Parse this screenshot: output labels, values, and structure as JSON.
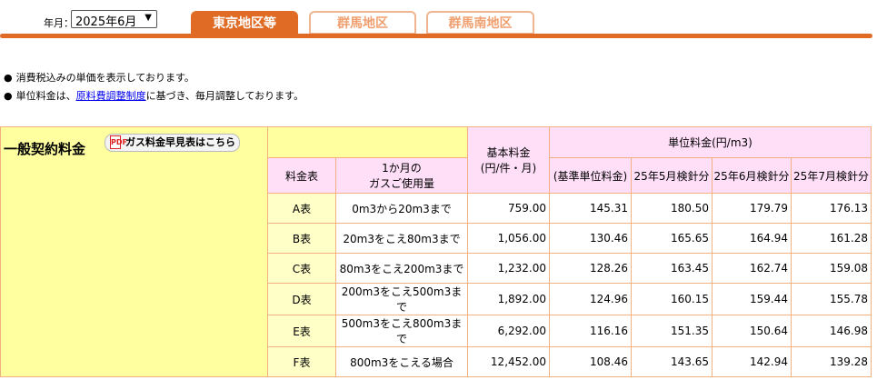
{
  "header": {
    "month_label": "年月：",
    "month_select_value": "2025年6月",
    "tabs": [
      {
        "label": "東京地区等",
        "active": true
      },
      {
        "label": "群馬地区",
        "active": false
      },
      {
        "label": "群馬南地区",
        "active": false
      }
    ]
  },
  "notes": {
    "line1": "消費税込みの単価を表示しております。",
    "line2_prefix": "単位料金は、",
    "line2_link": "原料費調整制度",
    "line2_suffix": "に基づき、毎月調整しております。",
    "bullet": "●"
  },
  "section": {
    "title": "一般契約料金",
    "pdf_button": "ガス料金早見表はこちら",
    "pdf_icon_text": "PDF"
  },
  "table": {
    "col_rate_table": "料金表",
    "col_usage_line1": "1か月の",
    "col_usage_line2": "ガスご使用量",
    "col_basic_line1": "基本料金",
    "col_basic_line2": "(円/件・月)",
    "col_unit_group": "単位料金(円/m3)",
    "col_unit_sub": [
      "(基準単位料金)",
      "25年5月検針分",
      "25年6月検針分",
      "25年7月検針分"
    ],
    "rows": [
      {
        "name": "A表",
        "usage": "0m3から20m3まで",
        "basic": "759.00",
        "u": [
          "145.31",
          "180.50",
          "179.79",
          "176.13"
        ]
      },
      {
        "name": "B表",
        "usage": "20m3をこえ80m3まで",
        "basic": "1,056.00",
        "u": [
          "130.46",
          "165.65",
          "164.94",
          "161.28"
        ]
      },
      {
        "name": "C表",
        "usage": "80m3をこえ200m3まで",
        "basic": "1,232.00",
        "u": [
          "128.26",
          "163.45",
          "162.74",
          "159.08"
        ]
      },
      {
        "name": "D表",
        "usage": "200m3をこえ500m3まで",
        "basic": "1,892.00",
        "u": [
          "124.96",
          "160.15",
          "159.44",
          "155.78"
        ]
      },
      {
        "name": "E表",
        "usage": "500m3をこえ800m3まで",
        "basic": "6,292.00",
        "u": [
          "116.16",
          "151.35",
          "150.64",
          "146.98"
        ]
      },
      {
        "name": "F表",
        "usage": "800m3をこえる場合",
        "basic": "12,452.00",
        "u": [
          "108.46",
          "143.65",
          "142.94",
          "139.28"
        ]
      }
    ]
  },
  "colors": {
    "accent": "#e06b25",
    "section_bg": "#ffffa0",
    "header_pink": "#ffdff8",
    "border": "#f0b080"
  }
}
